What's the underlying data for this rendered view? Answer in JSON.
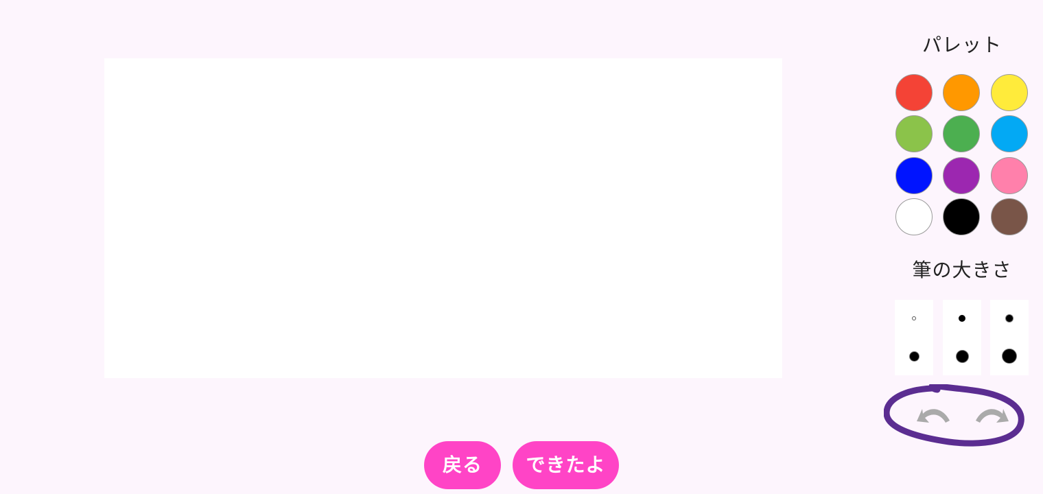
{
  "palette": {
    "title": "パレット",
    "colors": [
      {
        "name": "red",
        "hex": "#f44336"
      },
      {
        "name": "orange",
        "hex": "#ff9800"
      },
      {
        "name": "yellow",
        "hex": "#ffeb3b"
      },
      {
        "name": "light-green",
        "hex": "#8bc34a"
      },
      {
        "name": "green",
        "hex": "#4caf50"
      },
      {
        "name": "light-blue",
        "hex": "#03a9f4"
      },
      {
        "name": "blue",
        "hex": "#0014ff"
      },
      {
        "name": "purple",
        "hex": "#9c27b0"
      },
      {
        "name": "pink",
        "hex": "#ff80ab"
      },
      {
        "name": "white",
        "hex": "#ffffff"
      },
      {
        "name": "black",
        "hex": "#000000"
      },
      {
        "name": "brown",
        "hex": "#795548"
      }
    ]
  },
  "brush": {
    "title": "筆の大きさ",
    "sizes": [
      "1",
      "2",
      "3",
      "4",
      "5",
      "6"
    ]
  },
  "history": {
    "undo_icon": "undo-icon",
    "redo_icon": "redo-icon",
    "icon_color": "#aaaaaa",
    "highlight_color": "#5b2d91"
  },
  "actions": {
    "back_label": "戻る",
    "done_label": "できたよ",
    "button_color": "#ff44c6"
  }
}
